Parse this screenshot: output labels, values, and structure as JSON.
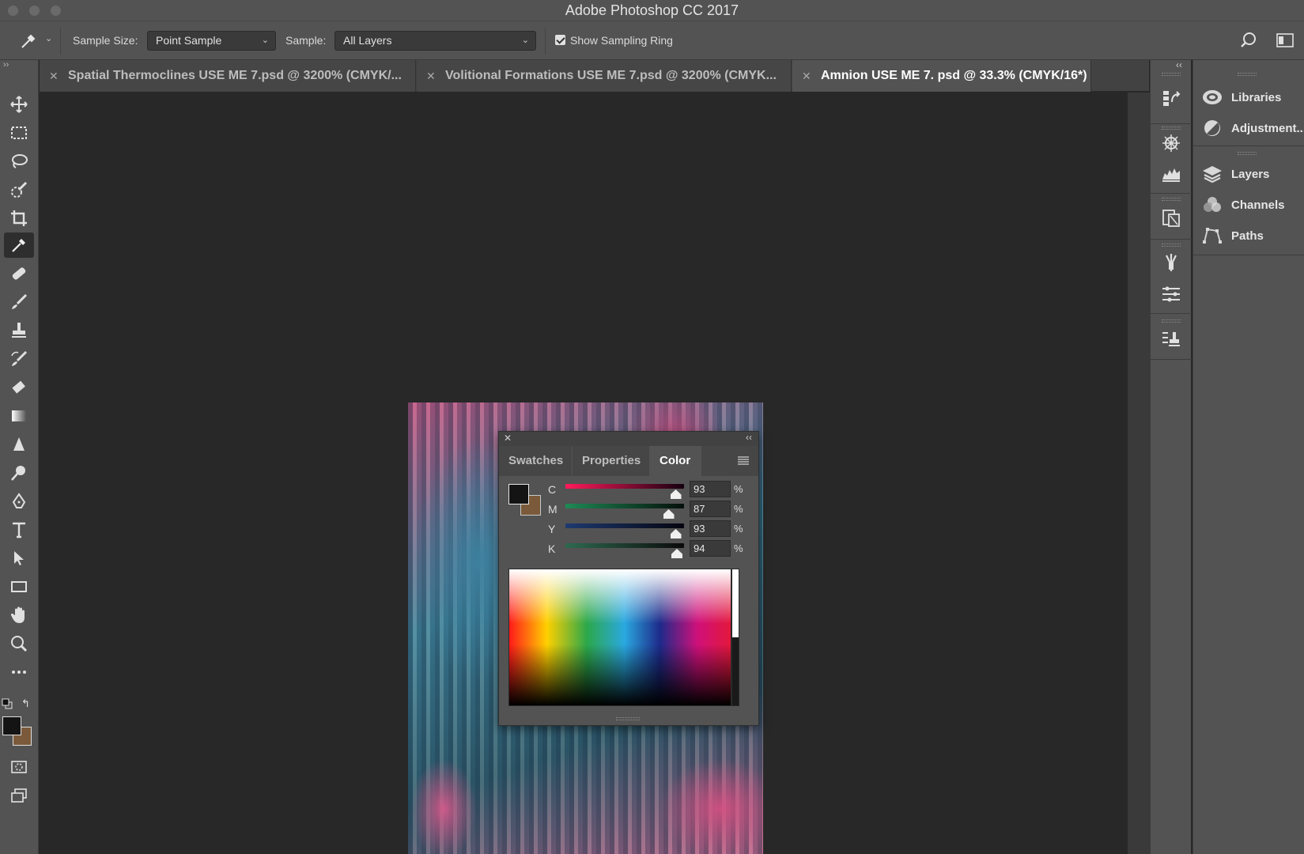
{
  "app": {
    "title": "Adobe Photoshop CC 2017"
  },
  "options": {
    "sample_size_label": "Sample Size:",
    "sample_size_value": "Point Sample",
    "sample_label": "Sample:",
    "sample_value": "All Layers",
    "sampling_ring_label": "Show Sampling Ring",
    "sampling_ring_checked": true
  },
  "tabs": [
    {
      "title": "Spatial Thermoclines USE ME 7.psd @ 3200% (CMYK/...",
      "active": false
    },
    {
      "title": "Volitional Formations USE ME 7.psd @ 3200% (CMYK...",
      "active": false
    },
    {
      "title": "Amnion USE ME 7. psd @ 33.3% (CMYK/16*)",
      "active": true
    }
  ],
  "color_panel": {
    "tabs": [
      "Swatches",
      "Properties",
      "Color"
    ],
    "active_tab": "Color",
    "foreground_color": "#141414",
    "background_color": "#7a5a3a",
    "channels": [
      {
        "label": "C",
        "value": "93",
        "unit": "%",
        "fraction": 0.93,
        "track": "linear-gradient(to right,#ff1a5a,#150010)"
      },
      {
        "label": "M",
        "value": "87",
        "unit": "%",
        "fraction": 0.87,
        "track": "linear-gradient(to right,#1e8a55,#050f0a)"
      },
      {
        "label": "Y",
        "value": "93",
        "unit": "%",
        "fraction": 0.93,
        "track": "linear-gradient(to right,#1e3a70,#050510)"
      },
      {
        "label": "K",
        "value": "94",
        "unit": "%",
        "fraction": 0.94,
        "track": "linear-gradient(to right,#2e6a50,#0a0a0a)"
      }
    ]
  },
  "right_panels": [
    "Libraries",
    "Adjustment...",
    "Layers",
    "Channels",
    "Paths"
  ],
  "colors": {
    "ui_gray": "#535353",
    "canvas_bg": "#282828",
    "accent_white": "#ffffff"
  }
}
